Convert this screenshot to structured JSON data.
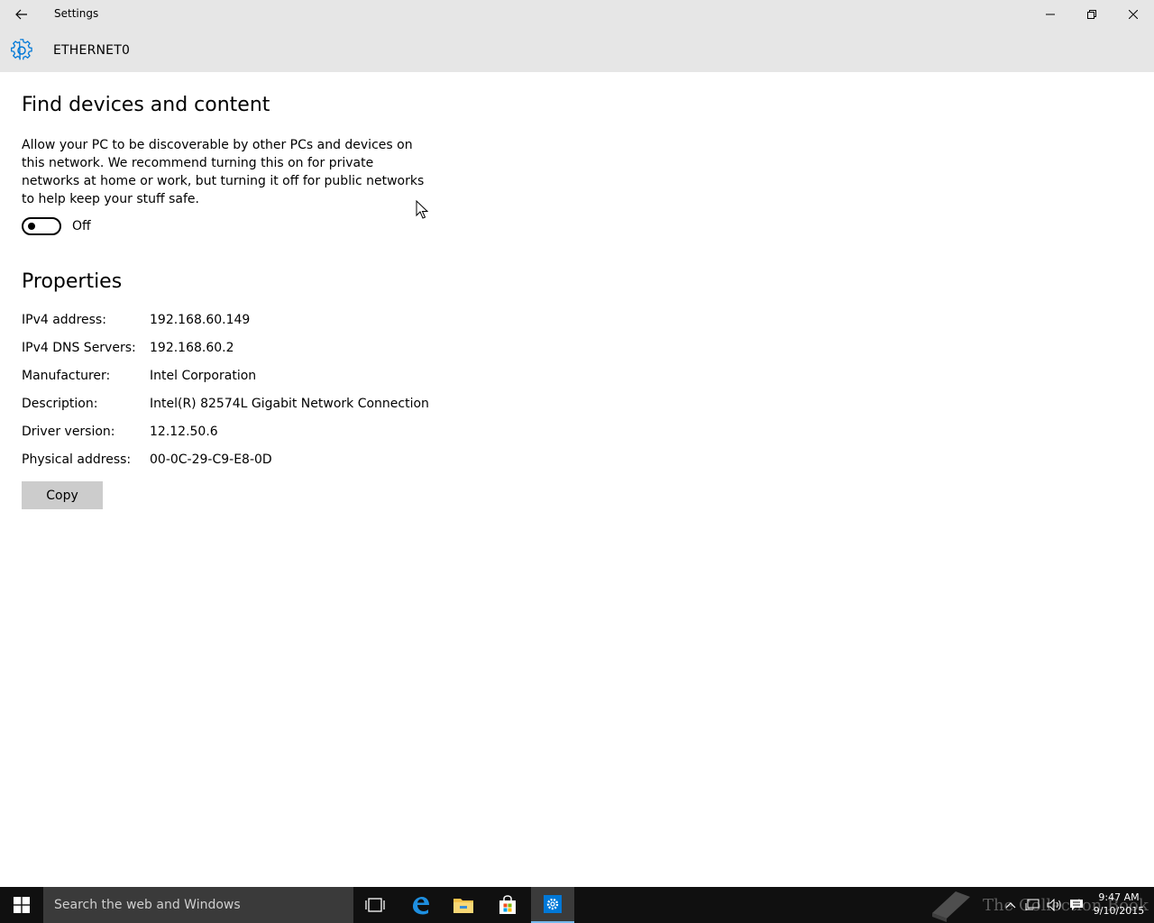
{
  "window": {
    "title": "Settings",
    "header_title": "ETHERNET0"
  },
  "discovery": {
    "title": "Find devices and content",
    "description": "Allow your PC to be discoverable by other PCs and devices on this network. We recommend turning this on for private networks at home or work, but turning it off for public networks to help keep your stuff safe.",
    "toggle_state": "Off"
  },
  "properties": {
    "title": "Properties",
    "rows": [
      {
        "label": "IPv4 address:",
        "value": "192.168.60.149"
      },
      {
        "label": "IPv4 DNS Servers:",
        "value": "192.168.60.2"
      },
      {
        "label": "Manufacturer:",
        "value": "Intel Corporation"
      },
      {
        "label": "Description:",
        "value": "Intel(R) 82574L Gigabit Network Connection"
      },
      {
        "label": "Driver version:",
        "value": "12.12.50.6"
      },
      {
        "label": "Physical address:",
        "value": "00-0C-29-C9-E8-0D"
      }
    ],
    "copy_label": "Copy"
  },
  "taskbar": {
    "search_placeholder": "Search the web and Windows",
    "time": "9:47 AM",
    "date": "9/10/2015",
    "watermark": "The Collection Book"
  },
  "colors": {
    "accent": "#0078d7",
    "header_bg": "#e6e6e6",
    "taskbar_bg": "#101010"
  }
}
